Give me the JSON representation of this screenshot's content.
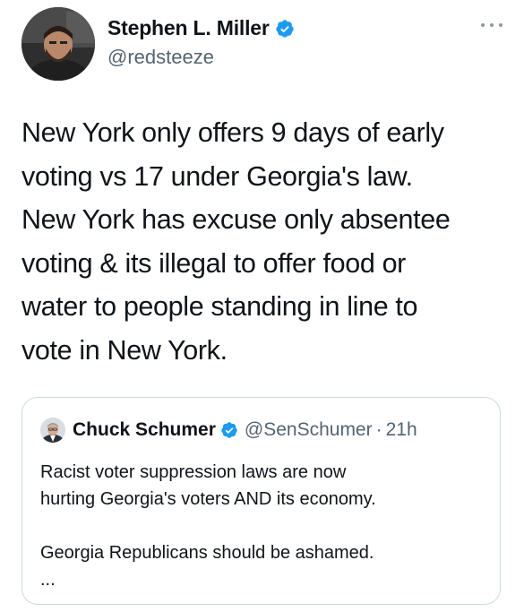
{
  "tweet": {
    "author": {
      "display_name": "Stephen L. Miller",
      "handle": "@redsteeze",
      "verified": true
    },
    "text": "New York only offers 9 days of early\nvoting vs 17 under Georgia's law.\nNew York has excuse only absentee\nvoting & its illegal to offer food or\nwater to people standing in line to\nvote in New York.",
    "more_icon": "more-horizontal-icon"
  },
  "quoted_tweet": {
    "author": {
      "display_name": "Chuck Schumer",
      "handle": "@SenSchumer",
      "verified": true
    },
    "separator": "·",
    "time": "21h",
    "text": "Racist voter suppression laws are now\nhurting Georgia's voters AND its economy.\n\nGeorgia Republicans should be ashamed.\n..."
  },
  "colors": {
    "verified_blue": "#1d9bf0",
    "secondary_text": "#536471",
    "primary_text": "#0f1419",
    "border": "#cfd9de"
  }
}
